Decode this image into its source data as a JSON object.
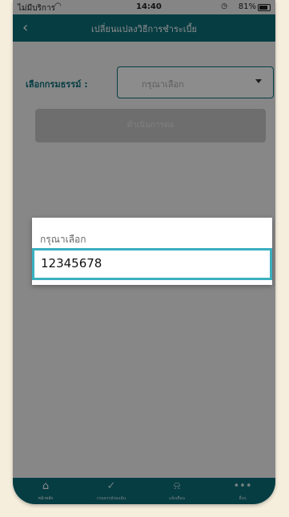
{
  "status": {
    "carrier": "ไม่มีบริการ",
    "time": "14:40",
    "battery": "81%"
  },
  "header": {
    "back_icon": "chevron-left-icon",
    "title": "เปลี่ยนแปลงวิธีการชำระเบี้ย"
  },
  "form": {
    "select_label": "เลือกกรมธรรม์ :",
    "select_placeholder": "กรุณาเลือก",
    "action_button": "ดำเนินการต่อ"
  },
  "dialog": {
    "title": "กรุณาเลือก",
    "options": [
      "12345678"
    ]
  },
  "tabbar": {
    "items": [
      {
        "label": "หน้าหลัก",
        "icon": "home-icon"
      },
      {
        "label": "กรมธรรม์ของฉัน",
        "icon": "shield-check-icon"
      },
      {
        "label": "แจ้งเตือน",
        "icon": "bell-icon"
      },
      {
        "label": "อื่นๆ",
        "icon": "more-dots-icon"
      }
    ]
  },
  "colors": {
    "primary": "#0c6f7a",
    "highlight": "#3ab0c0",
    "background": "#f6eedd"
  }
}
